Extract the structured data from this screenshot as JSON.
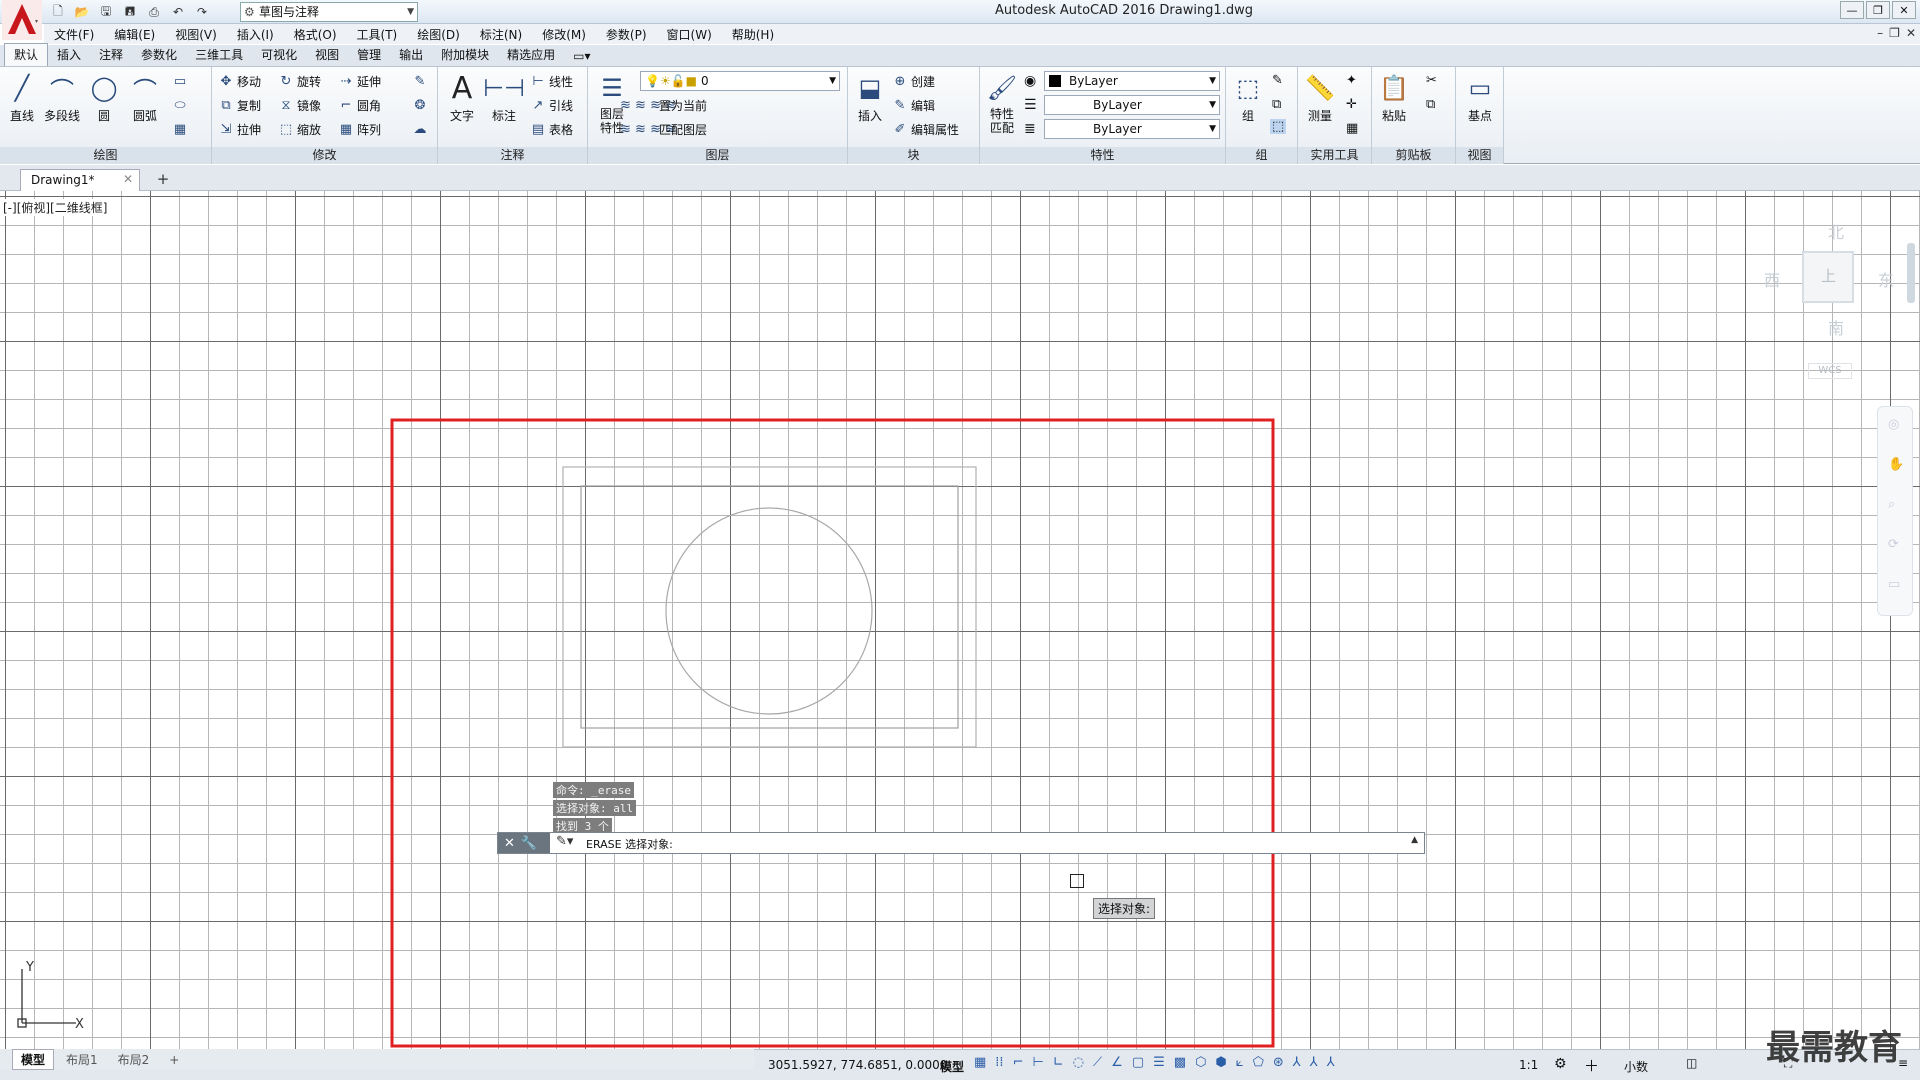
{
  "titlebar": {
    "workspace": "草图与注释",
    "title": "Autodesk AutoCAD 2016    Drawing1.dwg"
  },
  "menubar": {
    "items": [
      "文件(F)",
      "编辑(E)",
      "视图(V)",
      "插入(I)",
      "格式(O)",
      "工具(T)",
      "绘图(D)",
      "标注(N)",
      "修改(M)",
      "参数(P)",
      "窗口(W)",
      "帮助(H)"
    ]
  },
  "ribbon_tabs": [
    "默认",
    "插入",
    "注释",
    "参数化",
    "三维工具",
    "可视化",
    "视图",
    "管理",
    "输出",
    "附加模块",
    "精选应用"
  ],
  "ribbon": {
    "draw": {
      "title": "绘图",
      "line": "直线",
      "polyline": "多段线",
      "circle": "圆",
      "arc": "圆弧"
    },
    "modify": {
      "title": "修改",
      "move": "移动",
      "rotate": "旋转",
      "extend": "延伸",
      "copy": "复制",
      "mirror": "镜像",
      "fillet": "圆角",
      "stretch": "拉伸",
      "scale": "缩放",
      "array": "阵列"
    },
    "annotation": {
      "title": "注释",
      "text": "文字",
      "dimension": "标注",
      "linear": "线性",
      "leader": "引线",
      "table": "表格"
    },
    "layers": {
      "title": "图层",
      "layer_props": "图层\n特性",
      "current_layer": "0",
      "set_current": "置为当前",
      "match_layer": "匹配图层"
    },
    "block": {
      "title": "块",
      "insert": "插入",
      "create": "创建",
      "edit": "编辑",
      "edit_attr": "编辑属性"
    },
    "properties": {
      "title": "特性",
      "match": "特性\n匹配",
      "color": "ByLayer",
      "linetype": "ByLayer",
      "lineweight": "ByLayer"
    },
    "groups": {
      "title": "组",
      "group": "组"
    },
    "utilities": {
      "title": "实用工具",
      "measure": "测量"
    },
    "clipboard": {
      "title": "剪贴板",
      "paste": "粘贴"
    },
    "view": {
      "title": "视图",
      "base": "基点"
    }
  },
  "filetab": {
    "name": "Drawing1*"
  },
  "viewport": {
    "label": "[-][俯视][二维线框]"
  },
  "viewcube": {
    "north": "北",
    "south": "南",
    "east": "东",
    "west": "西",
    "top": "上",
    "wcs": "WCS"
  },
  "command": {
    "history": [
      "命令: _erase",
      "选择对象: all",
      "找到 3 个"
    ],
    "prompt": "ERASE 选择对象:",
    "tooltip": "选择对象:"
  },
  "layout_tabs": [
    "模型",
    "布局1",
    "布局2"
  ],
  "statusbar": {
    "coords": "3051.5927, 774.6851, 0.0000",
    "space": "模型",
    "scale": "1:1",
    "units": "小数"
  },
  "watermark": "最需教育",
  "colors": {
    "selection": "#e02020",
    "accent": "#2a4b7c"
  }
}
